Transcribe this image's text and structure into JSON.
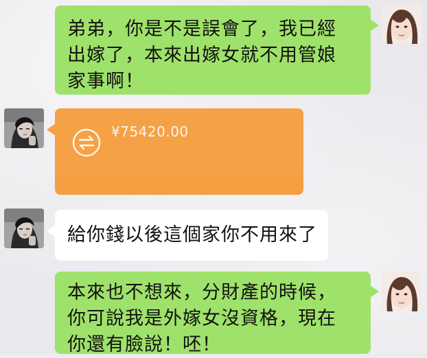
{
  "messages": [
    {
      "id": "m1",
      "side": "right",
      "type": "text",
      "text": "弟弟，你是不是誤會了，我已經\n出嫁了，本來出嫁女就不用管娘\n家事啊！"
    },
    {
      "id": "m2",
      "side": "left",
      "type": "transfer",
      "amount": "¥75420.00",
      "icon": "transfer-arrows-icon"
    },
    {
      "id": "m3",
      "side": "left",
      "type": "text",
      "text": "給你錢以後這個家你不用來了"
    },
    {
      "id": "m4",
      "side": "right",
      "type": "text",
      "text": "本來也不想來，分財產的時候，\n你可說我是外嫁女沒資格，現在\n你還有臉說！呸！"
    }
  ],
  "colors": {
    "green_bubble": "#9fe26b",
    "white_bubble": "#ffffff",
    "transfer_orange": "#f5a145",
    "background": "#e9e8ec"
  }
}
